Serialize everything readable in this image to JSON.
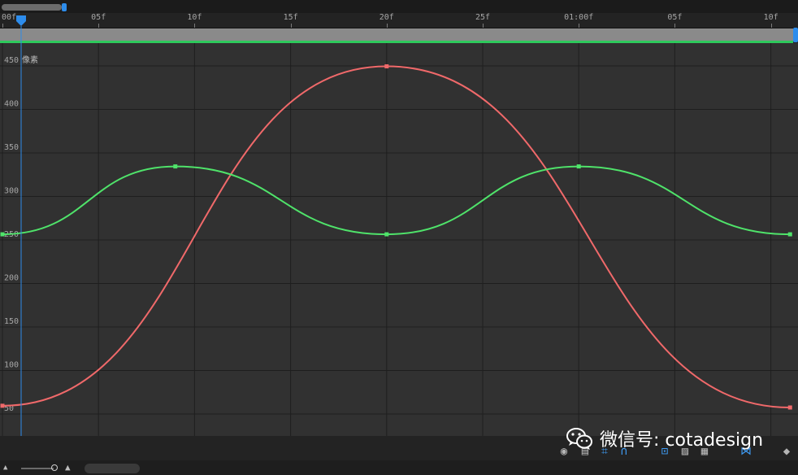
{
  "ruler": {
    "labels": [
      "00f",
      "05f",
      "10f",
      "15f",
      "20f",
      "25f",
      "01:00f",
      "05f",
      "10f"
    ]
  },
  "graph": {
    "unit_label": "像素",
    "y_labels": [
      "450",
      "400",
      "350",
      "300",
      "250",
      "200",
      "150",
      "100",
      "50"
    ]
  },
  "toolbar": {
    "icons": [
      "eye-icon",
      "graph-type-icon",
      "transform-box-icon",
      "snap-icon",
      "zoom-fit-icon",
      "fit-all-icon",
      "fit-selection-icon",
      "separate-dimensions-icon",
      "keyframe-diamond-icon"
    ]
  },
  "watermark": {
    "text": "微信号: cotadesign"
  },
  "colors": {
    "red_curve": "#f0696a",
    "green_curve": "#4fe36a",
    "playhead": "#2d8ceb"
  },
  "chart_data": {
    "type": "line",
    "ylabel": "像素",
    "x_unit": "frames",
    "ylim": [
      30,
      470
    ],
    "xlim": [
      0,
      41
    ],
    "series": [
      {
        "keyframes_x": [
          0,
          20,
          41
        ],
        "keyframes_y": [
          52,
          442,
          50
        ],
        "color": "#f0696a"
      },
      {
        "keyframes_x": [
          0,
          9,
          20,
          30,
          41
        ],
        "keyframes_y": [
          249,
          327,
          249,
          327,
          249
        ],
        "color": "#4fe36a"
      }
    ]
  }
}
